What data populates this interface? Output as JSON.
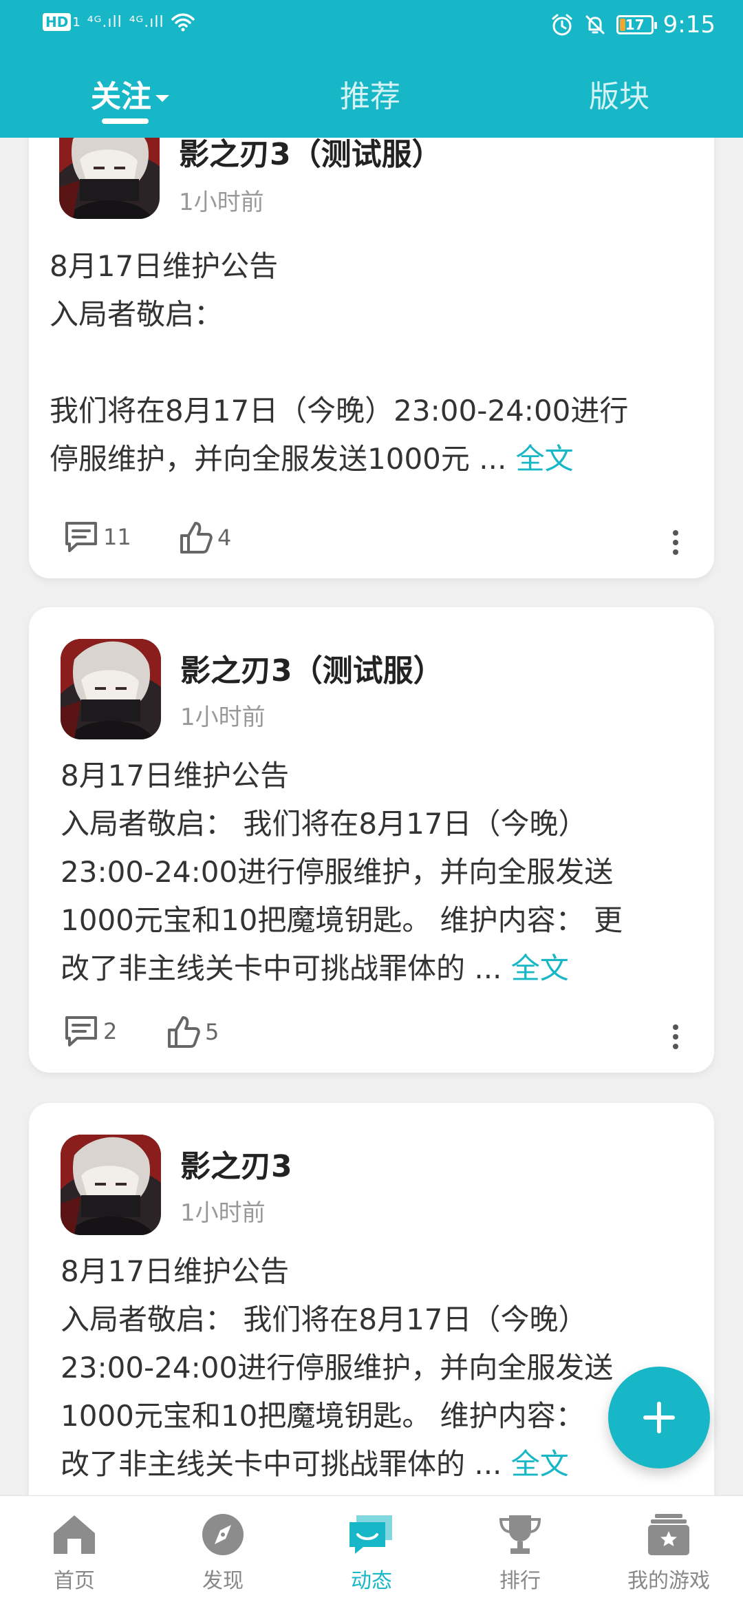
{
  "status_bar": {
    "hd": "HD",
    "hd_sub": "1",
    "signal_1": "⁴ᴳ.ıll",
    "signal_2": "⁴ᴳ.ıll",
    "battery": "17",
    "battery_level": 0.17,
    "time": "9:15"
  },
  "top_tabs": {
    "follow": "关注",
    "recommend": "推荐",
    "sections": "版块",
    "active": "follow"
  },
  "posts": [
    {
      "game": "影之刃3（测试服）",
      "time": "1小时前",
      "lines": [
        "8月17日维护公告",
        "入局者敬启：",
        "",
        "我们将在8月17日（今晚）23:00-24:00进行",
        "停服维护，并向全服发送1000元 ..."
      ],
      "more_link": "全文",
      "comments": "11",
      "likes": "4"
    },
    {
      "game": "影之刃3（测试服）",
      "time": "1小时前",
      "lines": [
        "8月17日维护公告",
        "入局者敬启： 我们将在8月17日（今晚）",
        "23:00-24:00进行停服维护，并向全服发送",
        "1000元宝和10把魔境钥匙。 维护内容： 更",
        "改了非主线关卡中可挑战罪体的 ..."
      ],
      "more_link": "全文",
      "comments": "2",
      "likes": "5"
    },
    {
      "game": "影之刃3",
      "time": "1小时前",
      "lines": [
        "8月17日维护公告",
        "入局者敬启： 我们将在8月17日（今晚）",
        "23:00-24:00进行停服维护，并向全服发送",
        "1000元宝和10把魔境钥匙。 维护内容：",
        "改了非主线关卡中可挑战罪体的 ..."
      ],
      "more_link": "全文"
    }
  ],
  "bottom_nav": {
    "home": "首页",
    "discover": "发现",
    "feed": "动态",
    "ranking": "排行",
    "my_games": "我的游戏",
    "active": "feed"
  },
  "colors": {
    "accent": "#17b7c7",
    "battery": "#f3a531"
  }
}
